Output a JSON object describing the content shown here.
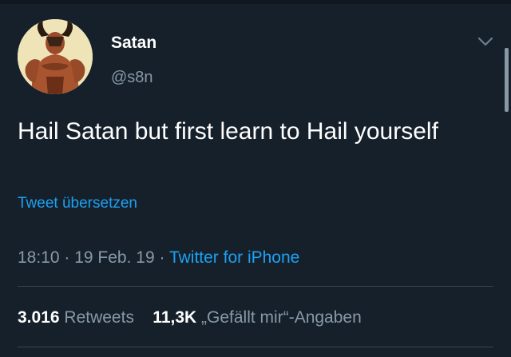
{
  "user": {
    "display_name": "Satan",
    "handle": "@s8n"
  },
  "tweet": {
    "text": "Hail Satan but first learn to Hail yourself",
    "translate_label": "Tweet übersetzen",
    "time": "18:10",
    "separator": " · ",
    "date": "19 Feb. 19",
    "source": "Twitter for iPhone"
  },
  "stats": {
    "retweets_count": "3.016",
    "retweets_label": "Retweets",
    "likes_count": "11,3K",
    "likes_label": "„Gefällt mir“-Angaben"
  },
  "icons": {
    "menu": "chevron-down-icon",
    "avatar": "avatar-image"
  },
  "colors": {
    "background": "#15202b",
    "accent": "#1da1f2",
    "secondary_text": "#8899a6",
    "divider": "#38444d"
  }
}
